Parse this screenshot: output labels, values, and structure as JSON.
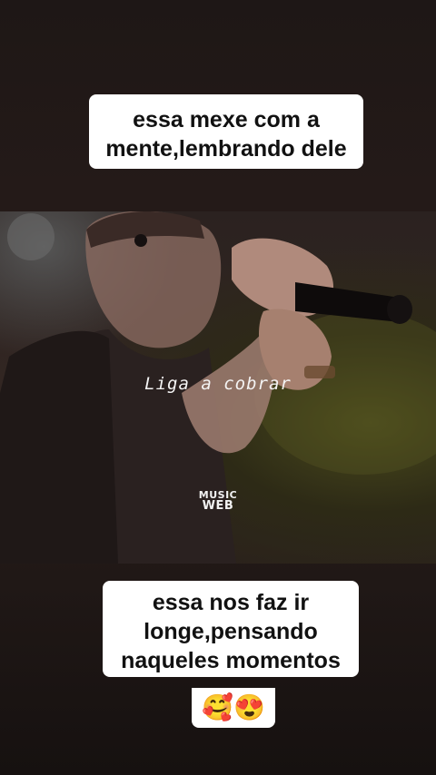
{
  "caption_top": {
    "line1": "essa mexe com a",
    "line2": "mente,lembrando dele"
  },
  "video": {
    "song_title": "Liga a cobrar",
    "watermark_line1": "MUSIC",
    "watermark_line2": "WEB"
  },
  "caption_bottom": {
    "line1": "essa nos faz ir",
    "line2": "longe,pensando",
    "line3": "naqueles momentos",
    "emojis": "🥰😍"
  }
}
